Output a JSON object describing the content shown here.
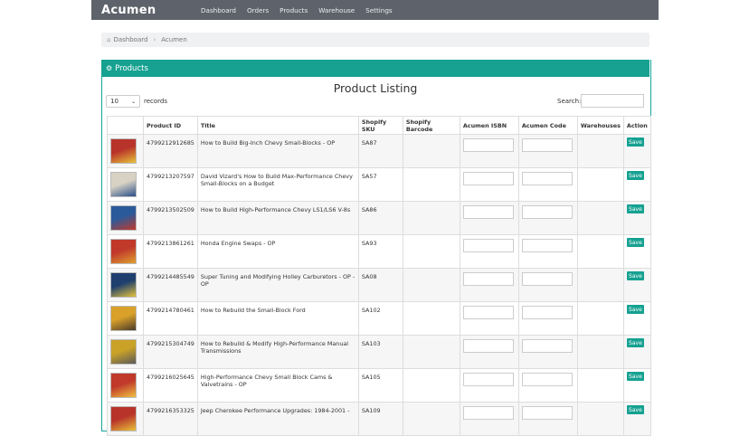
{
  "app": {
    "brand": "Acumen"
  },
  "nav": {
    "items": [
      "Dashboard",
      "Orders",
      "Products",
      "Warehouse",
      "Settings"
    ]
  },
  "breadcrumb": {
    "home": "Dashboard",
    "current": "Acumen"
  },
  "panel": {
    "title": "Products"
  },
  "listing": {
    "title": "Product Listing",
    "page_length": "10",
    "records_label": "records",
    "search_label": "Search:"
  },
  "table": {
    "headers": [
      "",
      "Product ID",
      "Title",
      "Shopify SKU",
      "Shopify Barcode",
      "Acumen ISBN",
      "Acumen Code",
      "Warehouses",
      "Action"
    ],
    "save_label": "Save",
    "rows": [
      {
        "product_id": "4799212912685",
        "title": "How to Build Big-Inch Chevy Small-Blocks - OP",
        "sku": "SA87",
        "thumb": [
          "#b8332a",
          "#e8c23a"
        ]
      },
      {
        "product_id": "4799213207597",
        "title": "David Vizard's How to Build Max-Performance Chevy Small-Blocks on a Budget",
        "sku": "SA57",
        "thumb": [
          "#d8d2c4",
          "#2a4f8a"
        ]
      },
      {
        "product_id": "4799213502509",
        "title": "How to Build High-Performance Chevy LS1/LS6 V-8s",
        "sku": "SA86",
        "thumb": [
          "#2b5a9a",
          "#c0392b"
        ]
      },
      {
        "product_id": "4799213861261",
        "title": "Honda Engine Swaps - OP",
        "sku": "SA93",
        "thumb": [
          "#c0392b",
          "#e0a030"
        ]
      },
      {
        "product_id": "4799214485549",
        "title": "Super Tuning and Modifying Holley Carburetors - OP - OP",
        "sku": "SA08",
        "thumb": [
          "#1f3f6e",
          "#e3c23b"
        ]
      },
      {
        "product_id": "4799214780461",
        "title": "How to Rebuild the Small-Block Ford",
        "sku": "SA102",
        "thumb": [
          "#d9a12a",
          "#4a3a2a"
        ]
      },
      {
        "product_id": "4799215304749",
        "title": "How to Rebuild & Modify High-Performance Manual Transmissions",
        "sku": "SA103",
        "thumb": [
          "#c9a227",
          "#5a5a5a"
        ]
      },
      {
        "product_id": "4799216025645",
        "title": "High-Performance Chevy Small Block Cams & Valvetrains - OP",
        "sku": "SA105",
        "thumb": [
          "#c0392b",
          "#f0c040"
        ]
      },
      {
        "product_id": "4799216353325",
        "title": "Jeep Cherokee Performance Upgrades: 1984-2001 -",
        "sku": "SA109",
        "thumb": [
          "#b8332a",
          "#e8c23a"
        ]
      }
    ]
  }
}
